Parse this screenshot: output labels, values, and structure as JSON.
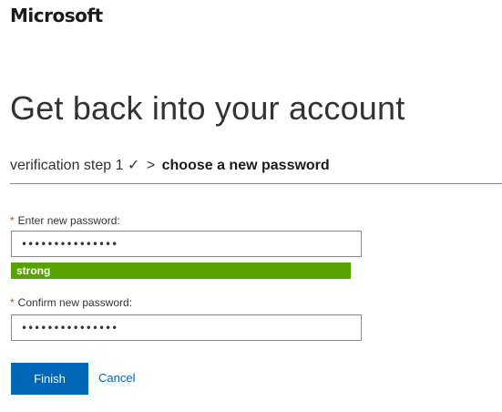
{
  "brand": {
    "logo_text": "Microsoft"
  },
  "title": "Get back into your account",
  "breadcrumb": {
    "step1": "verification step 1",
    "check": "✓",
    "separator": ">",
    "current": "choose a new password"
  },
  "form": {
    "required_marker": "*",
    "new_password": {
      "label": "Enter new password:",
      "value": "•••••••••••••••"
    },
    "strength": {
      "label": "strong",
      "color": "#57a300"
    },
    "confirm_password": {
      "label": "Confirm new password:",
      "value": "•••••••••••••••"
    }
  },
  "actions": {
    "finish_label": "Finish",
    "cancel_label": "Cancel"
  },
  "colors": {
    "accent": "#0067b8",
    "required": "#d83b01",
    "strength_strong": "#57a300"
  }
}
